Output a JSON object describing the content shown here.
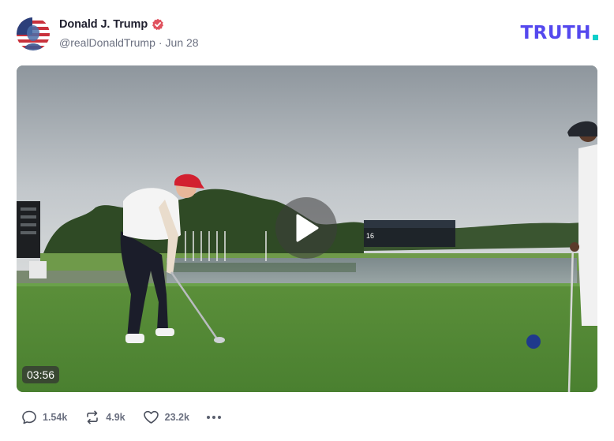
{
  "post": {
    "author_name": "Donald J. Trump",
    "handle": "@realDonaldTrump",
    "separator": "·",
    "date": "Jun 28",
    "verified": true,
    "avatar_icon": "flag-portrait-avatar"
  },
  "brand": {
    "logo_text": "TRUTH",
    "colors": {
      "primary": "#5448EE",
      "accent": "#0FCFCA"
    }
  },
  "video": {
    "duration": "03:56",
    "scoreboard_label": "16",
    "play_icon": "play-icon"
  },
  "actions": {
    "replies": "1.54k",
    "retruths": "4.9k",
    "likes": "23.2k",
    "more_icon": "more-dots-icon"
  },
  "colors": {
    "verified_badge": "#e0525e",
    "muted_text": "#6b7080"
  }
}
